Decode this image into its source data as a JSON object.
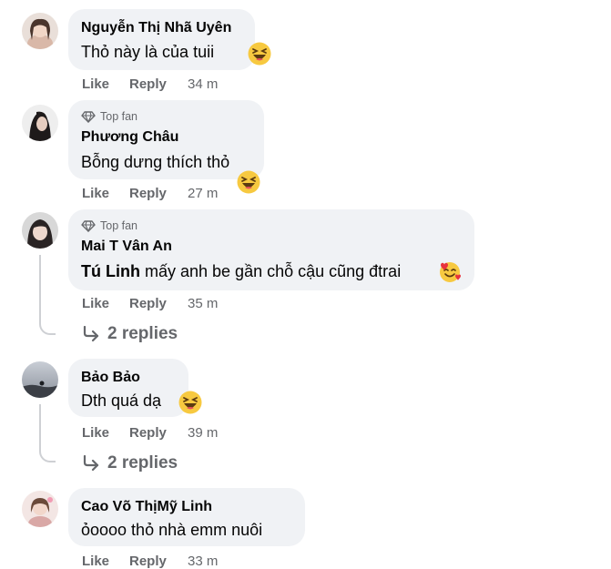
{
  "comments": [
    {
      "author": "Nguyễn Thị Nhã Uyên",
      "badge": "",
      "text": "Thỏ này là của tuii",
      "emoji": "laughing-emoji",
      "like": "Like",
      "reply": "Reply",
      "time": "34 m"
    },
    {
      "author": "Phương Châu",
      "badge": "Top fan",
      "text": "Bỗng dưng thích thỏ",
      "emoji": "laughing-emoji",
      "like": "Like",
      "reply": "Reply",
      "time": "27 m"
    },
    {
      "author": "Mai T Vân An",
      "badge": "Top fan",
      "mention": "Tú Linh",
      "text": "mấy anh be gần chỗ cậu cũng đtrai",
      "emoji": "smiling-face-with-hearts-emoji",
      "like": "Like",
      "reply": "Reply",
      "time": "35 m",
      "replies": "2 replies"
    },
    {
      "author": "Bảo Bảo",
      "badge": "",
      "text": "Dth quá dạ",
      "emoji": "laughing-emoji",
      "like": "Like",
      "reply": "Reply",
      "time": "39 m",
      "replies": "2 replies"
    },
    {
      "author": "Cao Võ ThịMỹ Linh",
      "badge": "",
      "text": "ỏoooo thỏ nhà emm nuôi",
      "like": "Like",
      "reply": "Reply",
      "time": "33 m"
    }
  ],
  "colors": {
    "bubble": "#f0f2f5",
    "secondary_text": "#65676b",
    "primary_text": "#050505",
    "thread_line": "#ced0d4"
  }
}
